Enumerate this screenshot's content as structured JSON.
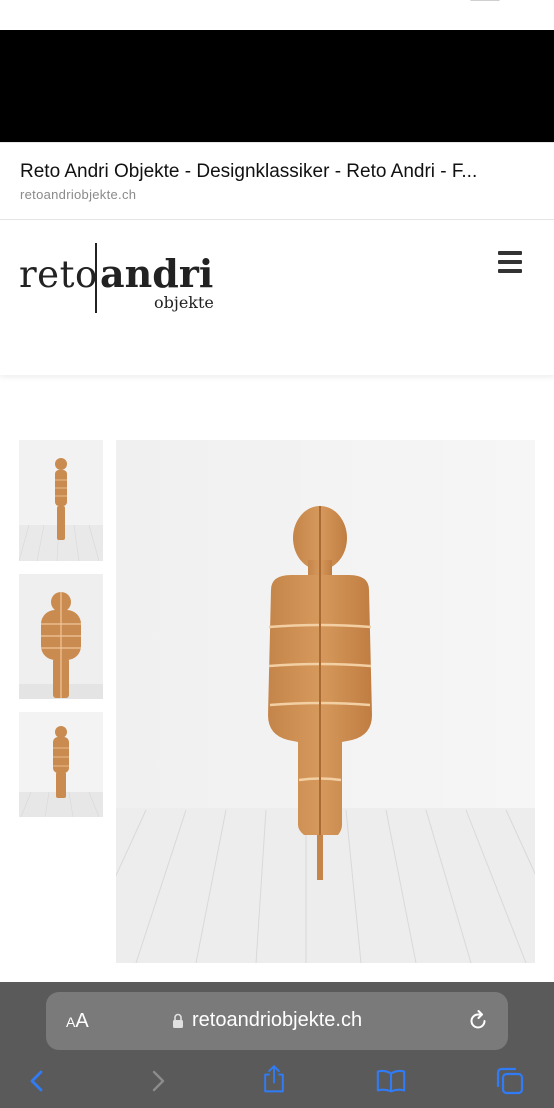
{
  "search_result": {
    "title": "Reto Andri Objekte - Designklassiker - Reto Andri - F...",
    "domain": "retoandriobjekte.ch"
  },
  "site": {
    "logo": {
      "first": "reto",
      "second": "andri",
      "sub": "objekte"
    }
  },
  "gallery": {
    "thumbnails": [
      "thumbnail-front-full",
      "thumbnail-close-up",
      "thumbnail-front-far"
    ],
    "selected_index": 0
  },
  "browser": {
    "aa_small": "A",
    "aa_large": "A",
    "url": "retoandriobjekte.ch",
    "icons": [
      "lock-icon",
      "reload-icon",
      "back-icon",
      "forward-icon",
      "share-icon",
      "bookmarks-icon",
      "tabs-icon"
    ],
    "colors": {
      "toolbar": "#5a5a5a",
      "url_field": "#7a7a7a",
      "nav_active": "#2f7cf6",
      "nav_disabled": "#8c8c8c"
    }
  }
}
